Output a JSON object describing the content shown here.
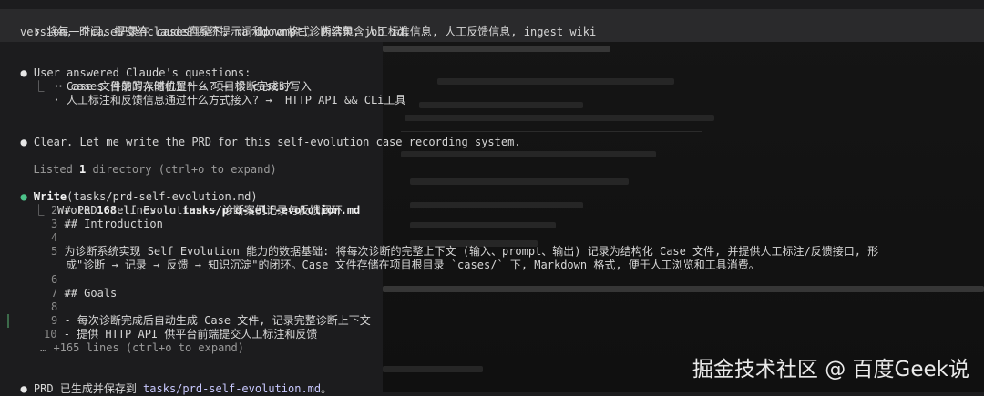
{
  "prompt": {
    "line1": " 将每一个case记录在 cases目录下, marddown格式。内容包含job id,",
    "line2": "version, 时间, 提交给claude的系统提示词和prompt,诊断结果, 人工标准信息, 人工反馈信息, ingest wiki"
  },
  "answers": {
    "header": "User answered Claude's questions:",
    "q1": "  · cases 目录的存储位置? → 项目根 cases/",
    "q2": "  · Case 文件的写入时机是什么? → 诊断完成时写入",
    "q3": "  · 人工标注和反馈信息通过什么方式接入? →  HTTP API && CLi工具"
  },
  "clear": "Clear. Let me write the PRD for this self-evolution case recording system.",
  "listed": {
    "prefix": "Listed ",
    "count": "1",
    "suffix": " directory (ctrl+o to expand)"
  },
  "write": {
    "tool": "Write",
    "arg": "(tasks/prd-self-evolution.md)",
    "wrote_prefix": "Wrote ",
    "wrote_count": "168",
    "wrote_mid": " lines to ",
    "wrote_path": "tasks/prd-self-evolution.md"
  },
  "file_lines": [
    {
      "n": "2",
      "t": "# PRD: Self Evolution — 诊断案例记录与反馈闭环"
    },
    {
      "n": "3",
      "t": "## Introduction"
    },
    {
      "n": "4",
      "t": ""
    },
    {
      "n": "5",
      "t": "为诊断系统实现 Self Evolution 能力的数据基础: 将每次诊断的完整上下文 (输入、prompt、输出) 记录为结构化 Case 文件, 并提供人工标注/反馈接口, 形"
    },
    {
      "n": "",
      "t": "成\"诊断 → 记录 → 反馈 → 知识沉淀\"的闭环。Case 文件存储在项目根目录 `cases/` 下, Markdown 格式, 便于人工浏览和工具消费。"
    },
    {
      "n": "6",
      "t": ""
    },
    {
      "n": "7",
      "t": "## Goals"
    },
    {
      "n": "8",
      "t": ""
    },
    {
      "n": "9",
      "t": "- 每次诊断完成后自动生成 Case 文件, 记录完整诊断上下文"
    },
    {
      "n": "10",
      "t": "- 提供 HTTP API 供平台前端提交人工标注和反馈"
    }
  ],
  "more": "… +165 lines (ctrl+o to expand)",
  "done": {
    "prefix": "PRD 已生成并保存到 ",
    "path": "tasks/prd-self-evolution.md",
    "suffix": "。"
  },
  "watermark": "掘金技术社区 @ 百度Geek说",
  "icons": {
    "bullet": "●",
    "corner": "⎿"
  }
}
